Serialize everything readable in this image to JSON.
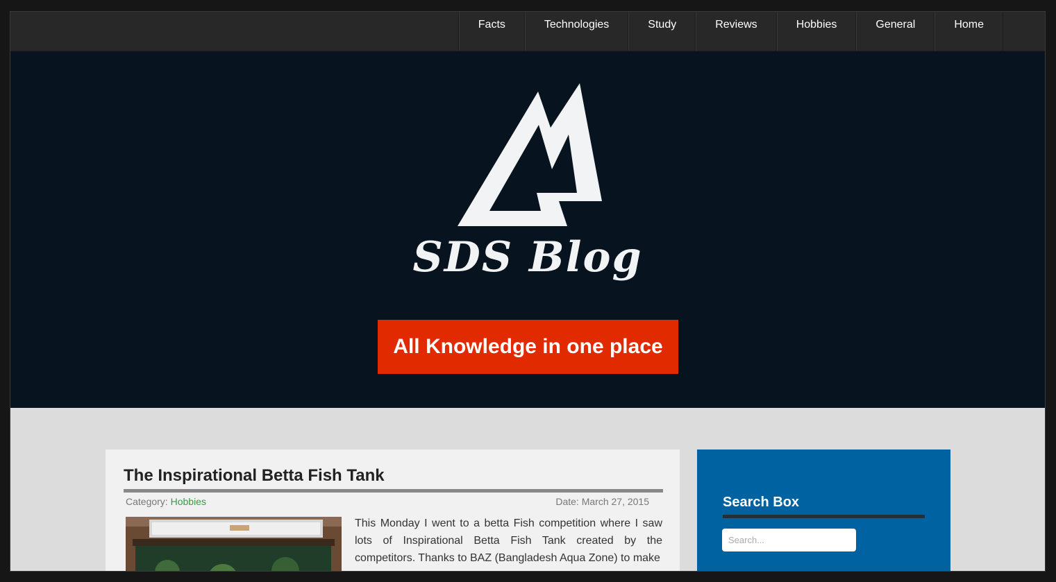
{
  "nav": {
    "items": [
      {
        "label": "Facts"
      },
      {
        "label": "Technologies"
      },
      {
        "label": "Study"
      },
      {
        "label": "Reviews"
      },
      {
        "label": "Hobbies"
      },
      {
        "label": "General"
      },
      {
        "label": "Home"
      }
    ]
  },
  "hero": {
    "logo_text": "SDS Blog",
    "tagline": "All Knowledge in one place",
    "colors": {
      "background": "#07131e",
      "tagline_bg": "#e22a00"
    }
  },
  "post": {
    "title": "The Inspirational Betta Fish Tank",
    "category_label": "Category:",
    "category_value": "Hobbies",
    "date": "Date: March 27, 2015",
    "excerpt": "This Monday I went to a betta Fish competition where I saw lots of Inspirational Betta Fish Tank created by the competitors. Thanks to BAZ (Bangladesh Aqua Zone) to make"
  },
  "sidebar": {
    "title": "Search Box",
    "search_placeholder": "Search...",
    "colors": {
      "background": "#0062a0"
    }
  }
}
